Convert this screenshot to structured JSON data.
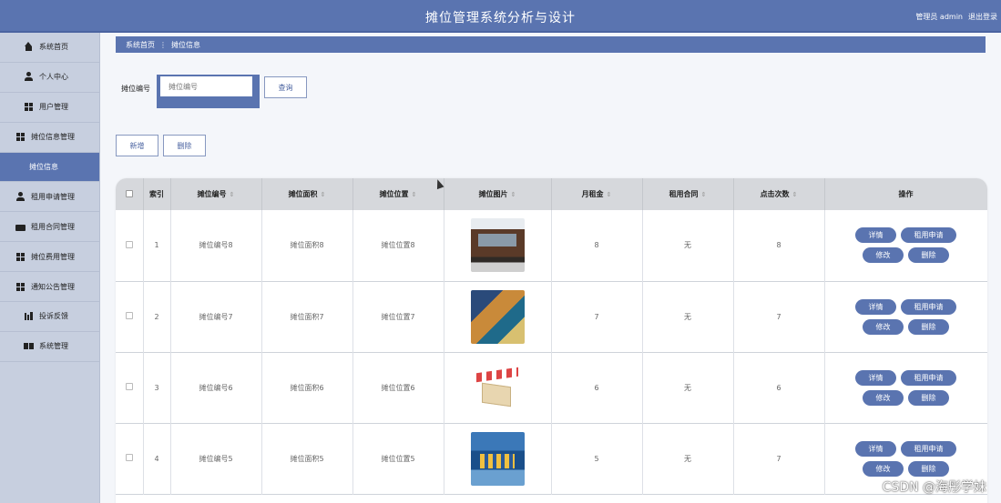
{
  "header": {
    "title": "摊位管理系统分析与设计",
    "user_label": "管理员 admin",
    "logout_label": "退出登录"
  },
  "sidebar": {
    "items": [
      {
        "label": "系统首页",
        "icon": "home-icon"
      },
      {
        "label": "个人中心",
        "icon": "user-icon"
      },
      {
        "label": "用户管理",
        "icon": "grid-icon"
      },
      {
        "label": "摊位信息管理",
        "icon": "grid-icon"
      },
      {
        "label": "摊位信息",
        "icon": ""
      },
      {
        "label": "租用申请管理",
        "icon": "user-icon"
      },
      {
        "label": "租用合同管理",
        "icon": "message-icon"
      },
      {
        "label": "摊位费用管理",
        "icon": "grid-icon"
      },
      {
        "label": "通知公告管理",
        "icon": "grid-icon"
      },
      {
        "label": "投诉反馈",
        "icon": "chart-icon"
      },
      {
        "label": "系统管理",
        "icon": "system-icon"
      }
    ]
  },
  "breadcrumb": {
    "home": "系统首页",
    "separator": "⋮",
    "current": "摊位信息"
  },
  "search": {
    "label": "摊位编号",
    "placeholder": "摊位编号",
    "button": "查询"
  },
  "toolbar": {
    "add_label": "新增",
    "delete_label": "删除"
  },
  "table": {
    "columns": [
      "索引",
      "摊位编号",
      "摊位面积",
      "摊位位置",
      "摊位图片",
      "月租金",
      "租用合同",
      "点击次数",
      "操作"
    ],
    "rows": [
      {
        "index": "1",
        "code": "摊位编号8",
        "area": "摊位面积8",
        "location": "摊位位置8",
        "image": "food-cart",
        "rent": "8",
        "contract": "无",
        "clicks": "8"
      },
      {
        "index": "2",
        "code": "摊位编号7",
        "area": "摊位面积7",
        "location": "摊位位置7",
        "image": "market-booth",
        "rent": "7",
        "contract": "无",
        "clicks": "7"
      },
      {
        "index": "3",
        "code": "摊位编号6",
        "area": "摊位面积6",
        "location": "摊位位置6",
        "image": "awning-stand",
        "rent": "6",
        "contract": "无",
        "clicks": "6"
      },
      {
        "index": "4",
        "code": "摊位编号5",
        "area": "摊位面积5",
        "location": "摊位位置5",
        "image": "kiosk",
        "rent": "5",
        "contract": "无",
        "clicks": "7"
      }
    ],
    "actions": {
      "detail": "详情",
      "apply": "租用申请",
      "edit": "修改",
      "delete": "删除"
    }
  },
  "colors": {
    "primary": "#5a74b0",
    "sidebar_bg": "#c7cfdf",
    "header_row": "#d6d8dc"
  },
  "watermark": "CSDN @海彤学妹"
}
